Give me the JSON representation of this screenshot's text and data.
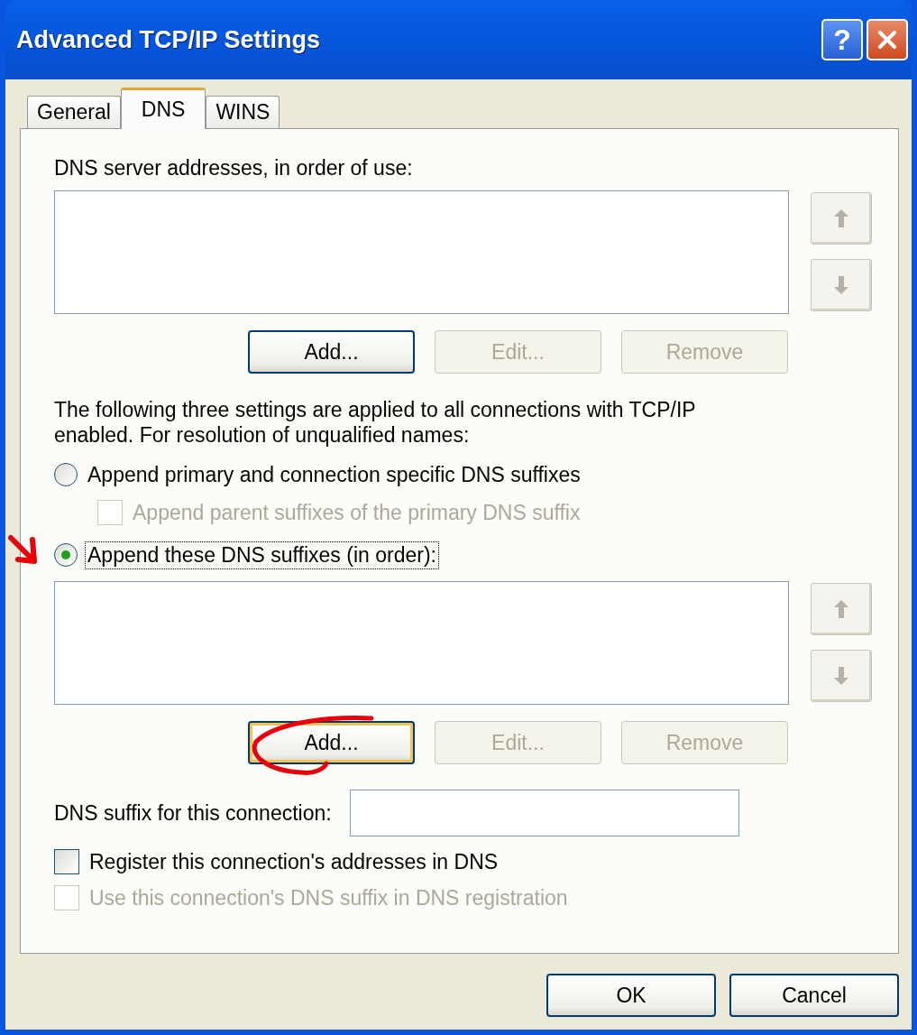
{
  "window": {
    "title": "Advanced TCP/IP Settings",
    "help_button": "?"
  },
  "tabs": [
    {
      "label": "General",
      "selected": false
    },
    {
      "label": "DNS",
      "selected": true
    },
    {
      "label": "WINS",
      "selected": false
    }
  ],
  "dns_servers": {
    "label": "DNS server addresses, in order of use:",
    "buttons": [
      {
        "label": "Add...",
        "disabled": false,
        "focused": false
      },
      {
        "label": "Edit...",
        "disabled": true,
        "focused": false
      },
      {
        "label": "Remove",
        "disabled": true,
        "focused": false
      }
    ]
  },
  "info_text": "The following three settings are applied to all connections with TCP/IP enabled. For resolution of unqualified names:",
  "resolution_options": [
    {
      "label": "Append primary and connection specific DNS suffixes",
      "selected": false,
      "sub_option": {
        "label": "Append parent suffixes of the primary DNS suffix",
        "checked": false,
        "disabled": true
      }
    },
    {
      "label": "Append these DNS suffixes (in order):",
      "selected": true
    }
  ],
  "dns_suffixes": {
    "buttons": [
      {
        "label": "Add...",
        "disabled": false,
        "focused": true
      },
      {
        "label": "Edit...",
        "disabled": true,
        "focused": false
      },
      {
        "label": "Remove",
        "disabled": true,
        "focused": false
      }
    ]
  },
  "connection_suffix": {
    "label": "DNS suffix for this connection:"
  },
  "checkboxes": [
    {
      "label": "Register this connection's addresses in DNS",
      "checked": false,
      "disabled": false
    },
    {
      "label": "Use this connection's DNS suffix in DNS registration",
      "checked": false,
      "disabled": true
    }
  ],
  "footer_buttons": [
    {
      "label": "OK"
    },
    {
      "label": "Cancel"
    }
  ]
}
